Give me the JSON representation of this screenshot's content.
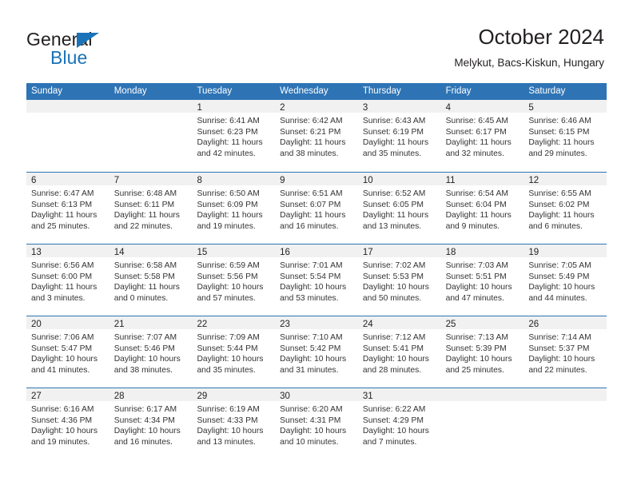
{
  "brand": {
    "name_top": "General",
    "name_bottom": "Blue",
    "triangle_color": "#1a73b8",
    "text_color": "#231f20"
  },
  "header": {
    "title": "October 2024",
    "subtitle": "Melykut, Bacs-Kiskun, Hungary"
  },
  "theme": {
    "header_blue": "#2e74b5",
    "daynum_band": "#f1f1f1",
    "body_text": "#333333"
  },
  "weekday_headers": [
    "Sunday",
    "Monday",
    "Tuesday",
    "Wednesday",
    "Thursday",
    "Friday",
    "Saturday"
  ],
  "weeks": [
    [
      {
        "day": "",
        "empty": true,
        "lines": []
      },
      {
        "day": "",
        "empty": true,
        "lines": []
      },
      {
        "day": "1",
        "empty": false,
        "lines": [
          "Sunrise: 6:41 AM",
          "Sunset: 6:23 PM",
          "Daylight: 11 hours",
          "and 42 minutes."
        ]
      },
      {
        "day": "2",
        "empty": false,
        "lines": [
          "Sunrise: 6:42 AM",
          "Sunset: 6:21 PM",
          "Daylight: 11 hours",
          "and 38 minutes."
        ]
      },
      {
        "day": "3",
        "empty": false,
        "lines": [
          "Sunrise: 6:43 AM",
          "Sunset: 6:19 PM",
          "Daylight: 11 hours",
          "and 35 minutes."
        ]
      },
      {
        "day": "4",
        "empty": false,
        "lines": [
          "Sunrise: 6:45 AM",
          "Sunset: 6:17 PM",
          "Daylight: 11 hours",
          "and 32 minutes."
        ]
      },
      {
        "day": "5",
        "empty": false,
        "lines": [
          "Sunrise: 6:46 AM",
          "Sunset: 6:15 PM",
          "Daylight: 11 hours",
          "and 29 minutes."
        ]
      }
    ],
    [
      {
        "day": "6",
        "empty": false,
        "lines": [
          "Sunrise: 6:47 AM",
          "Sunset: 6:13 PM",
          "Daylight: 11 hours",
          "and 25 minutes."
        ]
      },
      {
        "day": "7",
        "empty": false,
        "lines": [
          "Sunrise: 6:48 AM",
          "Sunset: 6:11 PM",
          "Daylight: 11 hours",
          "and 22 minutes."
        ]
      },
      {
        "day": "8",
        "empty": false,
        "lines": [
          "Sunrise: 6:50 AM",
          "Sunset: 6:09 PM",
          "Daylight: 11 hours",
          "and 19 minutes."
        ]
      },
      {
        "day": "9",
        "empty": false,
        "lines": [
          "Sunrise: 6:51 AM",
          "Sunset: 6:07 PM",
          "Daylight: 11 hours",
          "and 16 minutes."
        ]
      },
      {
        "day": "10",
        "empty": false,
        "lines": [
          "Sunrise: 6:52 AM",
          "Sunset: 6:05 PM",
          "Daylight: 11 hours",
          "and 13 minutes."
        ]
      },
      {
        "day": "11",
        "empty": false,
        "lines": [
          "Sunrise: 6:54 AM",
          "Sunset: 6:04 PM",
          "Daylight: 11 hours",
          "and 9 minutes."
        ]
      },
      {
        "day": "12",
        "empty": false,
        "lines": [
          "Sunrise: 6:55 AM",
          "Sunset: 6:02 PM",
          "Daylight: 11 hours",
          "and 6 minutes."
        ]
      }
    ],
    [
      {
        "day": "13",
        "empty": false,
        "lines": [
          "Sunrise: 6:56 AM",
          "Sunset: 6:00 PM",
          "Daylight: 11 hours",
          "and 3 minutes."
        ]
      },
      {
        "day": "14",
        "empty": false,
        "lines": [
          "Sunrise: 6:58 AM",
          "Sunset: 5:58 PM",
          "Daylight: 11 hours",
          "and 0 minutes."
        ]
      },
      {
        "day": "15",
        "empty": false,
        "lines": [
          "Sunrise: 6:59 AM",
          "Sunset: 5:56 PM",
          "Daylight: 10 hours",
          "and 57 minutes."
        ]
      },
      {
        "day": "16",
        "empty": false,
        "lines": [
          "Sunrise: 7:01 AM",
          "Sunset: 5:54 PM",
          "Daylight: 10 hours",
          "and 53 minutes."
        ]
      },
      {
        "day": "17",
        "empty": false,
        "lines": [
          "Sunrise: 7:02 AM",
          "Sunset: 5:53 PM",
          "Daylight: 10 hours",
          "and 50 minutes."
        ]
      },
      {
        "day": "18",
        "empty": false,
        "lines": [
          "Sunrise: 7:03 AM",
          "Sunset: 5:51 PM",
          "Daylight: 10 hours",
          "and 47 minutes."
        ]
      },
      {
        "day": "19",
        "empty": false,
        "lines": [
          "Sunrise: 7:05 AM",
          "Sunset: 5:49 PM",
          "Daylight: 10 hours",
          "and 44 minutes."
        ]
      }
    ],
    [
      {
        "day": "20",
        "empty": false,
        "lines": [
          "Sunrise: 7:06 AM",
          "Sunset: 5:47 PM",
          "Daylight: 10 hours",
          "and 41 minutes."
        ]
      },
      {
        "day": "21",
        "empty": false,
        "lines": [
          "Sunrise: 7:07 AM",
          "Sunset: 5:46 PM",
          "Daylight: 10 hours",
          "and 38 minutes."
        ]
      },
      {
        "day": "22",
        "empty": false,
        "lines": [
          "Sunrise: 7:09 AM",
          "Sunset: 5:44 PM",
          "Daylight: 10 hours",
          "and 35 minutes."
        ]
      },
      {
        "day": "23",
        "empty": false,
        "lines": [
          "Sunrise: 7:10 AM",
          "Sunset: 5:42 PM",
          "Daylight: 10 hours",
          "and 31 minutes."
        ]
      },
      {
        "day": "24",
        "empty": false,
        "lines": [
          "Sunrise: 7:12 AM",
          "Sunset: 5:41 PM",
          "Daylight: 10 hours",
          "and 28 minutes."
        ]
      },
      {
        "day": "25",
        "empty": false,
        "lines": [
          "Sunrise: 7:13 AM",
          "Sunset: 5:39 PM",
          "Daylight: 10 hours",
          "and 25 minutes."
        ]
      },
      {
        "day": "26",
        "empty": false,
        "lines": [
          "Sunrise: 7:14 AM",
          "Sunset: 5:37 PM",
          "Daylight: 10 hours",
          "and 22 minutes."
        ]
      }
    ],
    [
      {
        "day": "27",
        "empty": false,
        "lines": [
          "Sunrise: 6:16 AM",
          "Sunset: 4:36 PM",
          "Daylight: 10 hours",
          "and 19 minutes."
        ]
      },
      {
        "day": "28",
        "empty": false,
        "lines": [
          "Sunrise: 6:17 AM",
          "Sunset: 4:34 PM",
          "Daylight: 10 hours",
          "and 16 minutes."
        ]
      },
      {
        "day": "29",
        "empty": false,
        "lines": [
          "Sunrise: 6:19 AM",
          "Sunset: 4:33 PM",
          "Daylight: 10 hours",
          "and 13 minutes."
        ]
      },
      {
        "day": "30",
        "empty": false,
        "lines": [
          "Sunrise: 6:20 AM",
          "Sunset: 4:31 PM",
          "Daylight: 10 hours",
          "and 10 minutes."
        ]
      },
      {
        "day": "31",
        "empty": false,
        "lines": [
          "Sunrise: 6:22 AM",
          "Sunset: 4:29 PM",
          "Daylight: 10 hours",
          "and 7 minutes."
        ]
      },
      {
        "day": "",
        "empty": true,
        "lines": []
      },
      {
        "day": "",
        "empty": true,
        "lines": []
      }
    ]
  ]
}
